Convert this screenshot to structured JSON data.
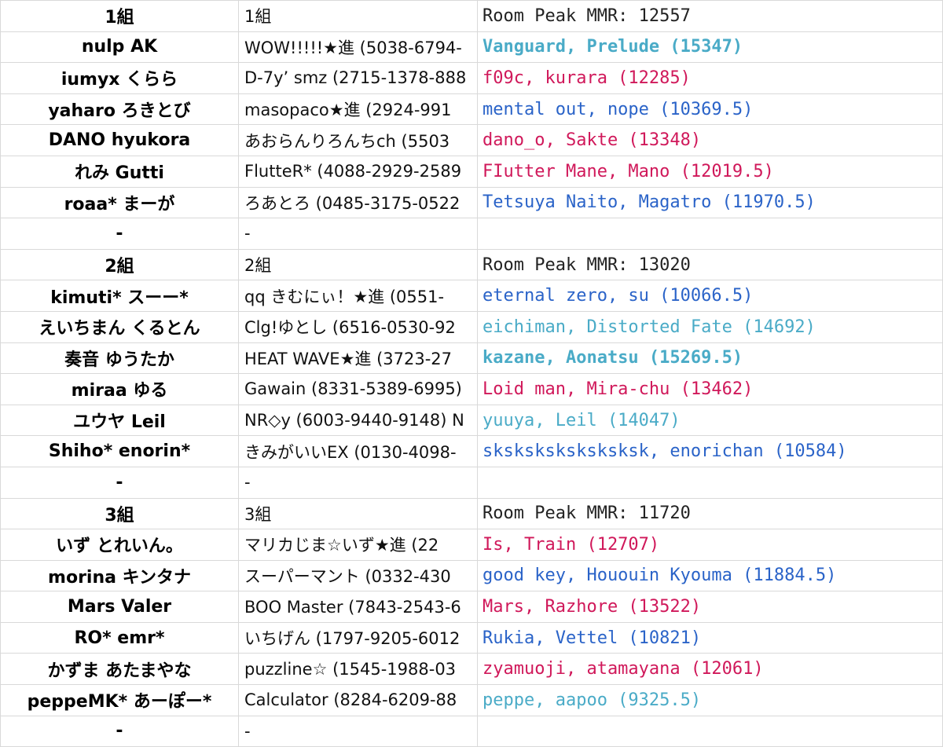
{
  "colors": {
    "pink": "#d0185a",
    "blue": "#2a63c8",
    "teal": "#4aabc7",
    "black": "#222222",
    "grid": "#d9d9d9"
  },
  "rows": [
    {
      "a": "1組",
      "b": "1組",
      "c": "Room Peak MMR: 12557",
      "color": "black",
      "bold": false
    },
    {
      "a": "nulp AK",
      "b": "WOW!!!!!★進 (5038-6794-",
      "c": "Vanguard, Prelude (15347)",
      "color": "teal",
      "bold": true
    },
    {
      "a": "iumyx くらら",
      "b": "D-7y’ smz (2715-1378-888",
      "c": "f09c, kurara (12285)",
      "color": "pink",
      "bold": false
    },
    {
      "a": "yaharo ろきとび",
      "b": "masopaco★進 (2924-991",
      "c": "mental out, nope (10369.5)",
      "color": "blue",
      "bold": false
    },
    {
      "a": "DANO hyukora",
      "b": "あおらんりろんちch (5503",
      "c": "dano_o, Sakte (13348)",
      "color": "pink",
      "bold": false
    },
    {
      "a": "れみ Gutti",
      "b": "FlutteR* (4088-2929-2589",
      "c": "FIutter Mane, Mano (12019.5)",
      "color": "pink",
      "bold": false
    },
    {
      "a": "roaa* まーが",
      "b": "ろあとろ (0485-3175-0522",
      "c": "Tetsuya Naito, Magatro (11970.5)",
      "color": "blue",
      "bold": false
    },
    {
      "a": "-",
      "b": "-",
      "c": "",
      "color": "black",
      "bold": false
    },
    {
      "a": "2組",
      "b": "2組",
      "c": "Room Peak MMR: 13020",
      "color": "black",
      "bold": false
    },
    {
      "a": "kimuti* スーー*",
      "b": "qq きむにぃ！★進 (0551-",
      "c": "eternal zero, su (10066.5)",
      "color": "blue",
      "bold": false
    },
    {
      "a": "えいちまん くるとん",
      "b": "Clg!ゆとし (6516-0530-92",
      "c": "eichiman, Distorted Fate (14692)",
      "color": "teal",
      "bold": false
    },
    {
      "a": "奏音 ゆうたか",
      "b": "HEAT WAVE★進 (3723-27",
      "c": "kazane, Aonatsu (15269.5)",
      "color": "teal",
      "bold": true
    },
    {
      "a": "miraa ゆる",
      "b": "Gawain (8331-5389-6995)",
      "c": "Loid man, Mira-chu (13462)",
      "color": "pink",
      "bold": false
    },
    {
      "a": "ユウヤ Leil",
      "b": "NR◇y (6003-9440-9148) N",
      "c": "yuuya, Leil (14047)",
      "color": "teal",
      "bold": false
    },
    {
      "a": "Shiho* enorin*",
      "b": "きみがいいEX (0130-4098-",
      "c": "sksksksksksksksk, enorichan (10584)",
      "color": "blue",
      "bold": false
    },
    {
      "a": "-",
      "b": "-",
      "c": "",
      "color": "black",
      "bold": false
    },
    {
      "a": "3組",
      "b": "3組",
      "c": "Room Peak MMR: 11720",
      "color": "black",
      "bold": false
    },
    {
      "a": "いず とれいん。",
      "b": "マリカじま☆いず★進 (22",
      "c": "Is, Train (12707)",
      "color": "pink",
      "bold": false
    },
    {
      "a": "morina キンタナ",
      "b": "スーパーマント (0332-430",
      "c": "good key, Hououin Kyouma (11884.5)",
      "color": "blue",
      "bold": false
    },
    {
      "a": "Mars Valer",
      "b": "BOO Master (7843-2543-6",
      "c": "Mars, Razhore (13522)",
      "color": "pink",
      "bold": false
    },
    {
      "a": "RO* emr*",
      "b": "いちげん (1797-9205-6012",
      "c": "Rukia, Vettel (10821)",
      "color": "blue",
      "bold": false
    },
    {
      "a": "かずま あたまやな",
      "b": "puzzline☆ (1545-1988-03",
      "c": "zyamuoji, atamayana (12061)",
      "color": "pink",
      "bold": false
    },
    {
      "a": "peppeMK* あーぽー*",
      "b": "Calculator (8284-6209-88",
      "c": "peppe, aapoo (9325.5)",
      "color": "teal",
      "bold": false
    },
    {
      "a": "-",
      "b": "-",
      "c": "",
      "color": "black",
      "bold": false
    }
  ]
}
